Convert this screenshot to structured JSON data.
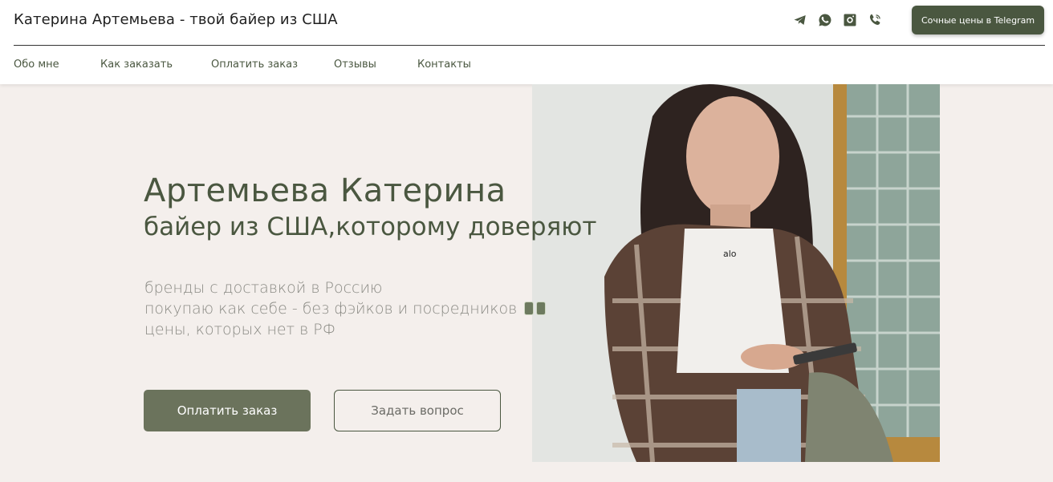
{
  "header": {
    "site_title": "Катерина Артемьева - твой байер из США",
    "social_icons": [
      "telegram-icon",
      "whatsapp-icon",
      "instagram-icon",
      "viber-icon"
    ],
    "cta_label": "Сочные цены в Telegram"
  },
  "nav": {
    "items": [
      "Обо мне",
      "Как заказать",
      "Оплатить заказ",
      "Отзывы",
      "Контакты"
    ]
  },
  "hero": {
    "name": "Артемьева Катерина",
    "tagline": "байер из США,которому доверяют",
    "bullets": [
      "бренды с доставкой в Россию",
      "покупаю как себе - без фэйков и посредников",
      "цены, которых нет в РФ"
    ],
    "primary_button": "Оплатить заказ",
    "secondary_button": "Задать вопрос"
  },
  "colors": {
    "accent": "#4a5740",
    "button": "#6b735c",
    "background": "#f4efec"
  }
}
